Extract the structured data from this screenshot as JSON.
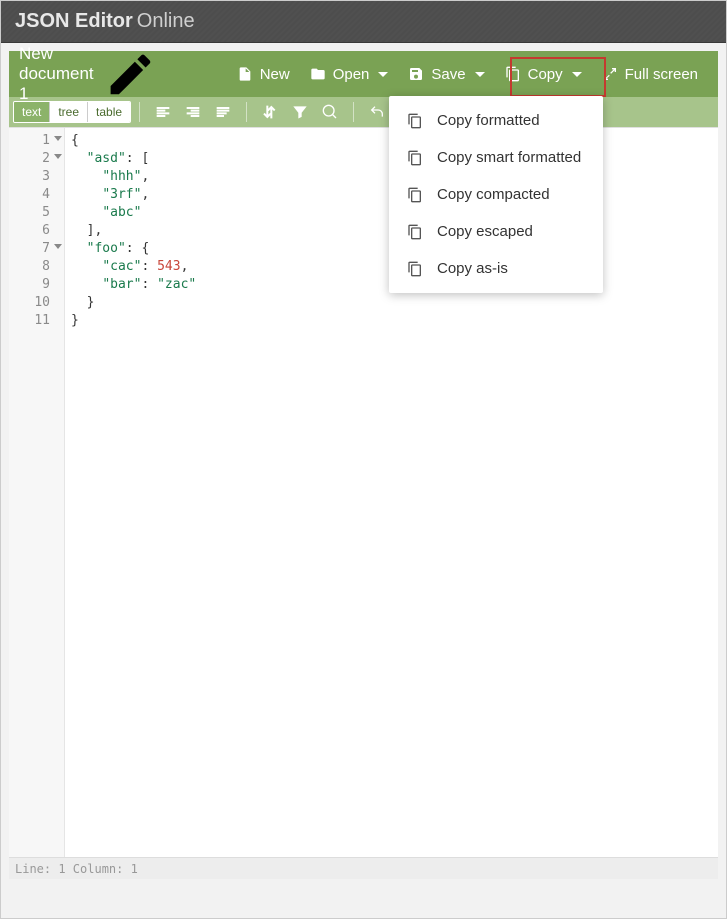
{
  "app": {
    "title_strong": "JSON Editor",
    "title_light": "Online"
  },
  "doc": {
    "name": "New document 1"
  },
  "menubar": {
    "new": "New",
    "open": "Open",
    "save": "Save",
    "copy": "Copy",
    "fullscreen": "Full screen"
  },
  "view_tabs": {
    "text": "text",
    "tree": "tree",
    "table": "table"
  },
  "dropdown": {
    "items": [
      "Copy formatted",
      "Copy smart formatted",
      "Copy compacted",
      "Copy escaped",
      "Copy as-is"
    ]
  },
  "code": {
    "lines": [
      {
        "n": "1",
        "html": "<span class='tok-brace'>{</span>"
      },
      {
        "n": "2",
        "html": "  <span class='tok-key'>\"asd\"</span><span class='tok-punct'>:</span> <span class='tok-punct'>[</span>"
      },
      {
        "n": "3",
        "html": "    <span class='tok-str'>\"hhh\"</span><span class='tok-punct'>,</span>"
      },
      {
        "n": "4",
        "html": "    <span class='tok-str'>\"3rf\"</span><span class='tok-punct'>,</span>"
      },
      {
        "n": "5",
        "html": "    <span class='tok-str'>\"abc\"</span>"
      },
      {
        "n": "6",
        "html": "  <span class='tok-punct'>],</span>"
      },
      {
        "n": "7",
        "html": "  <span class='tok-key'>\"foo\"</span><span class='tok-punct'>:</span> <span class='tok-brace'>{</span>"
      },
      {
        "n": "8",
        "html": "    <span class='tok-key'>\"cac\"</span><span class='tok-punct'>:</span> <span class='tok-num'>543</span><span class='tok-punct'>,</span>"
      },
      {
        "n": "9",
        "html": "    <span class='tok-key'>\"bar\"</span><span class='tok-punct'>:</span> <span class='tok-str'>\"zac\"</span>"
      },
      {
        "n": "10",
        "html": "  <span class='tok-brace'>}</span>"
      },
      {
        "n": "11",
        "html": "<span class='tok-brace'>}</span>"
      }
    ],
    "fold_lines": [
      1,
      2,
      7
    ]
  },
  "status": {
    "text": "Line: 1  Column: 1"
  }
}
